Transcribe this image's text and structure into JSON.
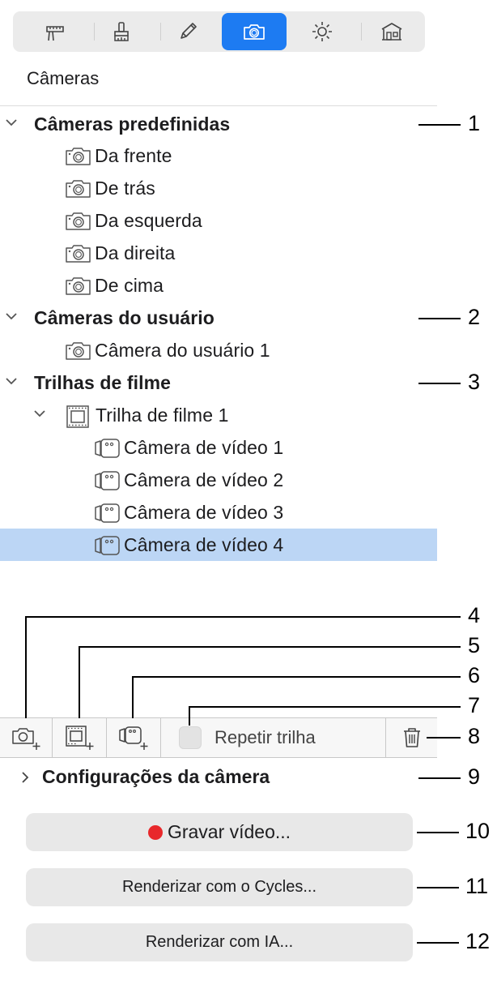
{
  "toolbar": {
    "tabs": [
      {
        "icon": "ruler-icon",
        "active": false
      },
      {
        "icon": "brush-icon",
        "active": false
      },
      {
        "icon": "pencil-icon",
        "active": false
      },
      {
        "icon": "camera-icon",
        "active": true
      },
      {
        "icon": "sun-icon",
        "active": false
      },
      {
        "icon": "house-icon",
        "active": false
      }
    ]
  },
  "panel": {
    "title": "Câmeras"
  },
  "tree": {
    "predefined": {
      "label": "Câmeras predefinidas",
      "items": [
        "Da frente",
        "De trás",
        "Da esquerda",
        "Da direita",
        "De cima"
      ]
    },
    "user": {
      "label": "Câmeras do usuário",
      "items": [
        "Câmera do usuário 1"
      ]
    },
    "tracks": {
      "label": "Trilhas de filme",
      "track": {
        "label": "Trilha de filme 1",
        "items": [
          "Câmera de vídeo 1",
          "Câmera de vídeo 2",
          "Câmera de vídeo 3",
          "Câmera de vídeo 4"
        ],
        "selected_index": 3
      }
    }
  },
  "bottom_bar": {
    "repeat_label": "Repetir trilha"
  },
  "settings": {
    "label": "Configurações da câmera"
  },
  "buttons": {
    "record": "Gravar vídeo...",
    "render_cycles": "Renderizar com o Cycles...",
    "render_ai": "Renderizar com IA..."
  },
  "callouts": [
    "1",
    "2",
    "3",
    "4",
    "5",
    "6",
    "7",
    "8",
    "9",
    "10",
    "11",
    "12"
  ],
  "colors": {
    "accent": "#1d7bf2",
    "selection": "#bcd6f5",
    "record": "#e8282b"
  }
}
